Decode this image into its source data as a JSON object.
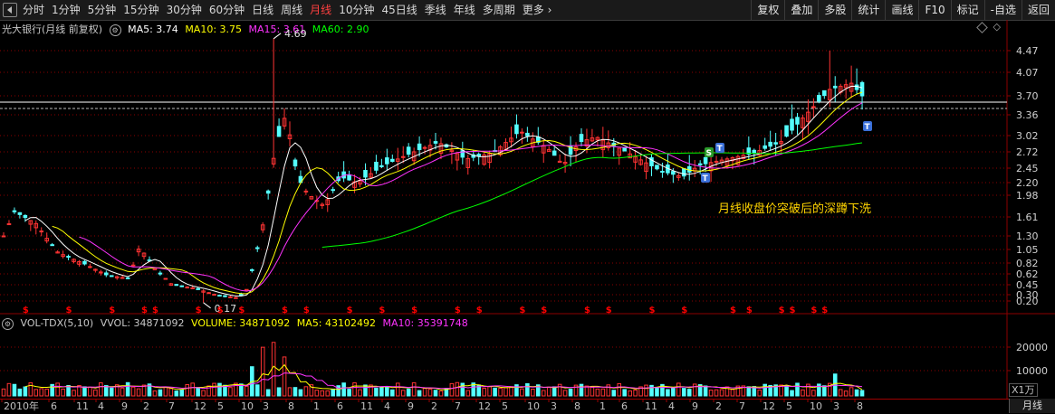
{
  "toolbar": {
    "periods": [
      "分时",
      "1分钟",
      "5分钟",
      "15分钟",
      "30分钟",
      "60分钟",
      "日线",
      "周线",
      "月线",
      "10分钟",
      "45日线",
      "季线",
      "年线",
      "多周期",
      "更多"
    ],
    "active": "月线",
    "right": [
      "复权",
      "叠加",
      "多股",
      "统计",
      "画线",
      "F10",
      "标记",
      "-自选",
      "返回"
    ]
  },
  "legend": {
    "title": "光大银行(月线 前复权)",
    "ma5": "MA5: 3.74",
    "ma10": "MA10: 3.75",
    "ma15": "MA15: 3.61",
    "ma60": "MA60: 2.90"
  },
  "vol_legend": {
    "name": "VOL-TDX(5,10)",
    "vvol": "VVOL: 34871092",
    "volume": "VOLUME: 34871092",
    "ma5": "MA5: 43102492",
    "ma10": "MA10: 35391748"
  },
  "price_axis": [
    "4.47",
    "4.07",
    "3.70",
    "3.36",
    "3.02",
    "2.72",
    "2.45",
    "2.20",
    "1.98",
    "1.61",
    "1.30",
    "1.05",
    "0.82",
    "0.62",
    "0.45",
    "0.30",
    "0.20"
  ],
  "volume_axis": [
    "20000",
    "10000"
  ],
  "volume_unit": "X1万",
  "annotations": {
    "high": "4.69",
    "low": "0.17",
    "note": "月线收盘价突破后的深蹲下洗"
  },
  "date_axis": [
    "2010年",
    "6",
    "11",
    "4",
    "9",
    "2",
    "7",
    "12",
    "5",
    "10",
    "3",
    "8",
    "1",
    "6",
    "11",
    "4",
    "9",
    "2",
    "7",
    "12",
    "5",
    "10",
    "3",
    "8",
    "1",
    "6",
    "11",
    "4",
    "9",
    "2",
    "7",
    "12",
    "5",
    "10",
    "3",
    "8"
  ],
  "bottom_tab": "月线",
  "markers": {
    "s": "S",
    "t": "T"
  },
  "colors": {
    "up": "#ff3333",
    "down": "#54ffff",
    "ma5": "#ffffff",
    "ma10": "#ffff00",
    "ma15": "#ff33ff",
    "ma60": "#00ff00",
    "grid": "#8b0000",
    "signal": "#ff0000"
  }
}
